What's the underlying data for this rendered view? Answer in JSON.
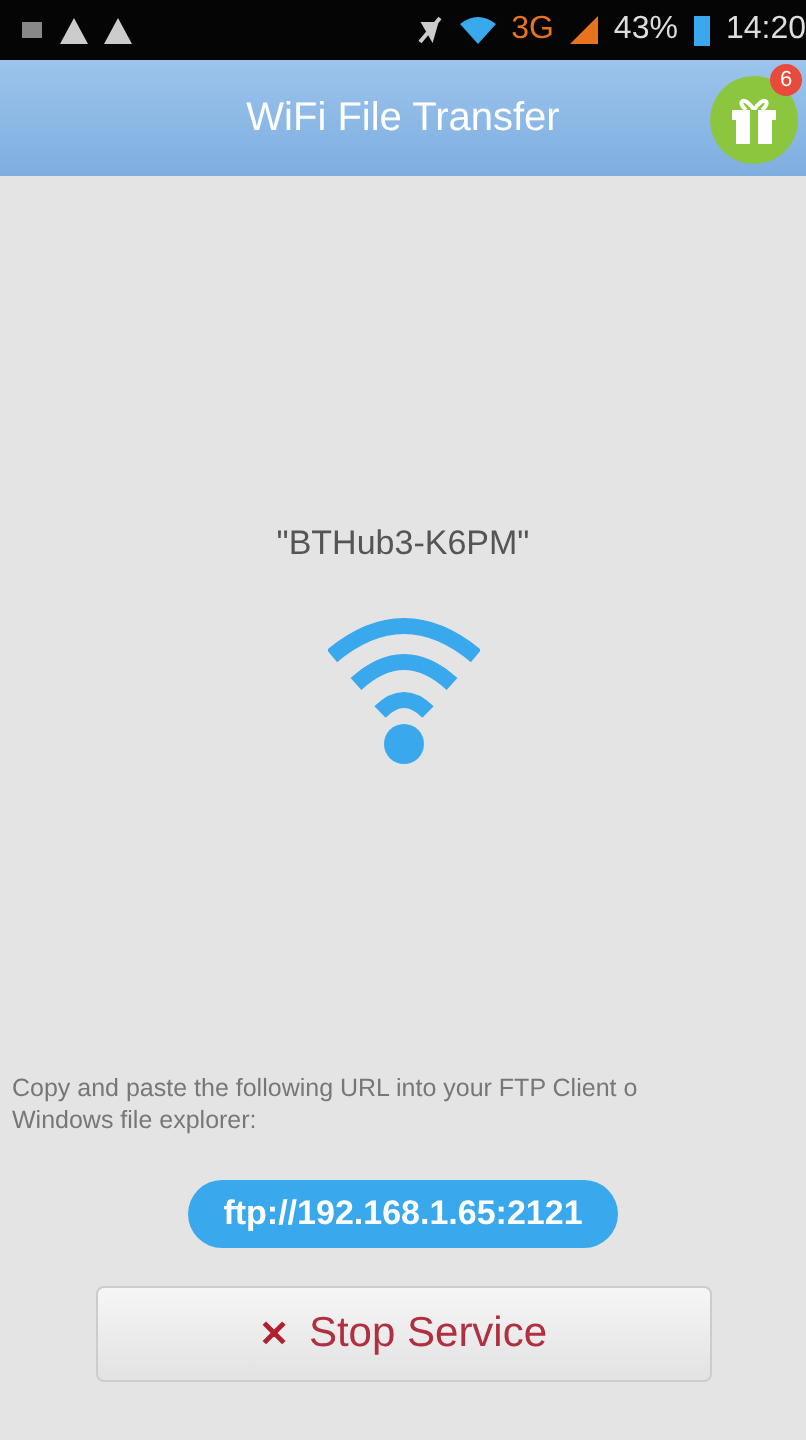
{
  "status_bar": {
    "network": "3G",
    "battery": "43%",
    "time": "14:20"
  },
  "header": {
    "title": "WiFi File Transfer",
    "gift_badge": "6"
  },
  "network_name": "\"BTHub3-K6PM\"",
  "instructions": [
    "Copy and paste the following URL into your FTP Client o",
    "Windows file explorer:"
  ],
  "url": "ftp://192.168.1.65:2121",
  "stop_button": {
    "icon": "✕",
    "label": "Stop Service"
  }
}
